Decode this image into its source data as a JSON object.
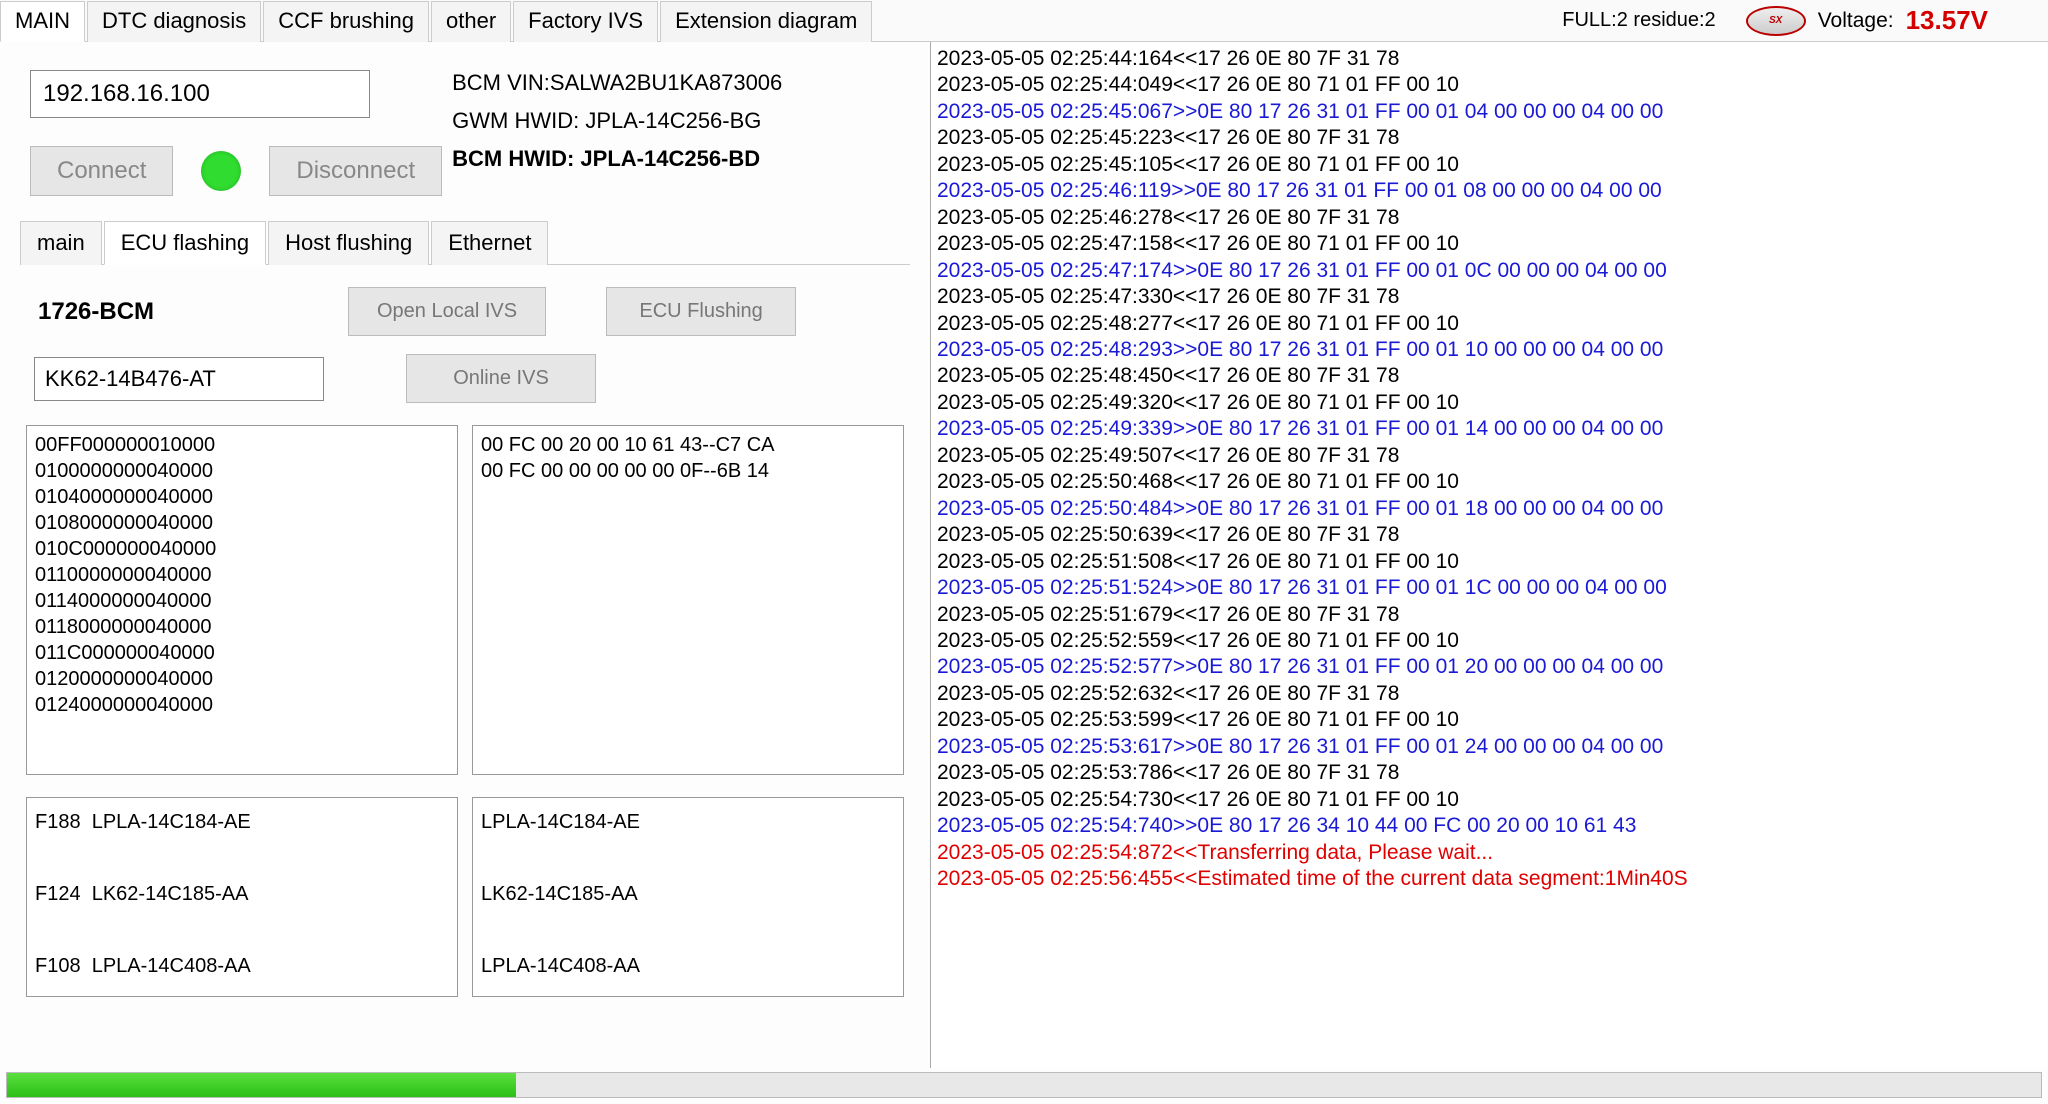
{
  "top_tabs": [
    "MAIN",
    "DTC diagnosis",
    "CCF brushing",
    "other",
    "Factory IVS",
    "Extension diagram"
  ],
  "top_tabs_active": 0,
  "status_full": "FULL:2 residue:2",
  "voltage_label": "Voltage:",
  "voltage_value": "13.57V",
  "ip_value": "192.168.16.100",
  "connect_label": "Connect",
  "disconnect_label": "Disconnect",
  "info": {
    "vin": "BCM VIN:SALWA2BU1KA873006",
    "gwm": "GWM HWID: JPLA-14C256-BG",
    "bcm": "BCM HWID: JPLA-14C256-BD"
  },
  "sub_tabs": [
    "main",
    "ECU flashing",
    "Host flushing",
    "Ethernet"
  ],
  "sub_tabs_active": 1,
  "ecu": {
    "title": "1726-BCM",
    "open_local": "Open Local IVS",
    "flush": "ECU Flushing",
    "part_value": "KK62-14B476-AT",
    "online": "Online IVS"
  },
  "list_a": "00FF000000010000\n0100000000040000\n0104000000040000\n0108000000040000\n010C000000040000\n0110000000040000\n0114000000040000\n0118000000040000\n011C000000040000\n0120000000040000\n0124000000040000",
  "list_b": "00 FC 00 20 00 10 61 43--C7 CA\n00 FC 00 00 00 00 00 0F--6B 14",
  "list_c": "F188  LPLA-14C184-AE\n\nF124  LK62-14C185-AA\n\nF108  LPLA-14C408-AA",
  "list_d": "LPLA-14C184-AE\n\nLK62-14C185-AA\n\nLPLA-14C408-AA",
  "log": [
    {
      "c": "k",
      "t": "2023-05-05 02:25:44:164<<17 26 0E 80 7F 31 78"
    },
    {
      "c": "k",
      "t": "2023-05-05 02:25:44:049<<17 26 0E 80 71 01 FF 00 10"
    },
    {
      "c": "b",
      "t": "2023-05-05 02:25:45:067>>0E 80 17 26 31 01 FF 00 01 04 00 00 00 04 00 00"
    },
    {
      "c": "k",
      "t": "2023-05-05 02:25:45:223<<17 26 0E 80 7F 31 78"
    },
    {
      "c": "k",
      "t": "2023-05-05 02:25:45:105<<17 26 0E 80 71 01 FF 00 10"
    },
    {
      "c": "b",
      "t": "2023-05-05 02:25:46:119>>0E 80 17 26 31 01 FF 00 01 08 00 00 00 04 00 00"
    },
    {
      "c": "k",
      "t": "2023-05-05 02:25:46:278<<17 26 0E 80 7F 31 78"
    },
    {
      "c": "k",
      "t": "2023-05-05 02:25:47:158<<17 26 0E 80 71 01 FF 00 10"
    },
    {
      "c": "b",
      "t": "2023-05-05 02:25:47:174>>0E 80 17 26 31 01 FF 00 01 0C 00 00 00 04 00 00"
    },
    {
      "c": "k",
      "t": "2023-05-05 02:25:47:330<<17 26 0E 80 7F 31 78"
    },
    {
      "c": "k",
      "t": "2023-05-05 02:25:48:277<<17 26 0E 80 71 01 FF 00 10"
    },
    {
      "c": "b",
      "t": "2023-05-05 02:25:48:293>>0E 80 17 26 31 01 FF 00 01 10 00 00 00 04 00 00"
    },
    {
      "c": "k",
      "t": "2023-05-05 02:25:48:450<<17 26 0E 80 7F 31 78"
    },
    {
      "c": "k",
      "t": "2023-05-05 02:25:49:320<<17 26 0E 80 71 01 FF 00 10"
    },
    {
      "c": "b",
      "t": "2023-05-05 02:25:49:339>>0E 80 17 26 31 01 FF 00 01 14 00 00 00 04 00 00"
    },
    {
      "c": "k",
      "t": "2023-05-05 02:25:49:507<<17 26 0E 80 7F 31 78"
    },
    {
      "c": "k",
      "t": "2023-05-05 02:25:50:468<<17 26 0E 80 71 01 FF 00 10"
    },
    {
      "c": "b",
      "t": "2023-05-05 02:25:50:484>>0E 80 17 26 31 01 FF 00 01 18 00 00 00 04 00 00"
    },
    {
      "c": "k",
      "t": "2023-05-05 02:25:50:639<<17 26 0E 80 7F 31 78"
    },
    {
      "c": "k",
      "t": "2023-05-05 02:25:51:508<<17 26 0E 80 71 01 FF 00 10"
    },
    {
      "c": "b",
      "t": "2023-05-05 02:25:51:524>>0E 80 17 26 31 01 FF 00 01 1C 00 00 00 04 00 00"
    },
    {
      "c": "k",
      "t": "2023-05-05 02:25:51:679<<17 26 0E 80 7F 31 78"
    },
    {
      "c": "k",
      "t": "2023-05-05 02:25:52:559<<17 26 0E 80 71 01 FF 00 10"
    },
    {
      "c": "b",
      "t": "2023-05-05 02:25:52:577>>0E 80 17 26 31 01 FF 00 01 20 00 00 00 04 00 00"
    },
    {
      "c": "k",
      "t": "2023-05-05 02:25:52:632<<17 26 0E 80 7F 31 78"
    },
    {
      "c": "k",
      "t": "2023-05-05 02:25:53:599<<17 26 0E 80 71 01 FF 00 10"
    },
    {
      "c": "b",
      "t": "2023-05-05 02:25:53:617>>0E 80 17 26 31 01 FF 00 01 24 00 00 00 04 00 00"
    },
    {
      "c": "k",
      "t": "2023-05-05 02:25:53:786<<17 26 0E 80 7F 31 78"
    },
    {
      "c": "k",
      "t": "2023-05-05 02:25:54:730<<17 26 0E 80 71 01 FF 00 10"
    },
    {
      "c": "b",
      "t": "2023-05-05 02:25:54:740>>0E 80 17 26 34 10 44 00 FC 00 20 00 10 61 43"
    },
    {
      "c": "r",
      "t": "2023-05-05 02:25:54:872<<Transferring data, Please wait..."
    },
    {
      "c": "r",
      "t": "2023-05-05 02:25:56:455<<Estimated time of the current data segment:1Min40S"
    }
  ],
  "progress_pct": 25
}
